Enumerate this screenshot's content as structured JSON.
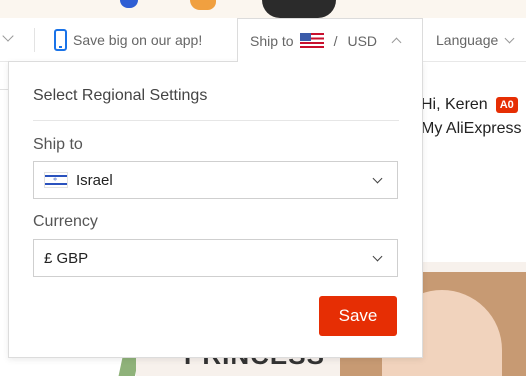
{
  "topbar": {
    "app_promo": "Save big on our app!",
    "ship_to_label": "Ship to",
    "ship_to_flag": "us-flag-icon",
    "separator": "/",
    "currency": "USD",
    "language_label": "Language"
  },
  "user": {
    "greeting": "Hi, Keren",
    "badge": "A0",
    "my_account": "My AliExpress"
  },
  "promo": {
    "title": "PRINCESS"
  },
  "regional_panel": {
    "title": "Select Regional Settings",
    "ship_to": {
      "label": "Ship to",
      "value": "Israel",
      "flag": "israel-flag-icon"
    },
    "currency": {
      "label": "Currency",
      "value": "£ GBP"
    },
    "save_label": "Save"
  },
  "colors": {
    "accent": "#e62e04",
    "app_icon": "#1a73e8"
  }
}
